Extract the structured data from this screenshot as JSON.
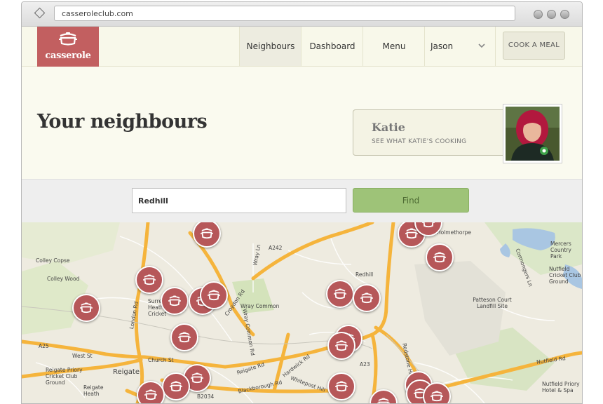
{
  "browser": {
    "url": "casseroleclub.com"
  },
  "header": {
    "logo_text": "casserole",
    "nav": [
      "Neighbours",
      "Dashboard",
      "Menu",
      "Jason"
    ],
    "cook_button": "COOK A MEAL"
  },
  "hero": {
    "title": "Your neighbours",
    "featured_name": "Katie",
    "featured_link": "SEE WHAT KATIE'S COOKING"
  },
  "search": {
    "value": "Redhill",
    "button": "Find"
  },
  "map": {
    "labels": [
      "Holmethorpe",
      "Colley Copse",
      "Colley Wood",
      "Mercers Country Park",
      "Nutfield Cricket Club Ground",
      "Patteson Court Landfill Site",
      "Wray Common",
      "Wray Ln",
      "A242",
      "A25",
      "West St",
      "Church St",
      "Reigate",
      "Reigate Priory Cricket Club Ground",
      "Reigate Heath",
      "Reigate Rd",
      "Hardwick Rd",
      "Blackborough Rd",
      "Whitepost Hill",
      "London Rd",
      "Croydon Rd",
      "Wray Common Rd",
      "Cormongers Ln",
      "Redstone Hill",
      "Nutfield Rd",
      "Nutfield Priory Hotel & Spa",
      "Redhill",
      "A23",
      "B2034",
      "Surrey Heath Cricket"
    ]
  },
  "colors": {
    "brand": "#c25f60",
    "find": "#9ec378",
    "pin": "#b65759",
    "road": "#f5b43c"
  }
}
